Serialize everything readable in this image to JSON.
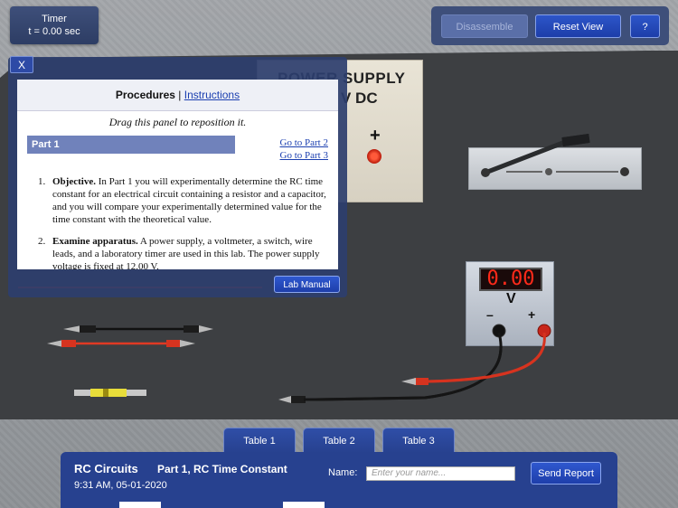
{
  "timer": {
    "label": "Timer",
    "value": "t = 0.00 sec"
  },
  "toolbar": {
    "disassemble": "Disassemble",
    "reset_view": "Reset View",
    "help": "?"
  },
  "power_supply": {
    "title_line1": "POWER SUPPLY",
    "title_line2": "V DC",
    "plus": "+"
  },
  "voltmeter": {
    "reading": "0.00",
    "unit": "V",
    "minus": "–",
    "plus": "+"
  },
  "panel": {
    "close": "X",
    "header_title": "Procedures",
    "header_sep": "|",
    "header_link": "Instructions",
    "drag_hint": "Drag this panel to reposition it.",
    "part_label": "Part 1",
    "goto_part2": "Go to Part 2",
    "goto_part3": "Go to Part 3",
    "items": [
      {
        "num": "1.",
        "title": "Objective.",
        "text": "In Part 1 you will experimentally determine the RC time constant for an electrical circuit containing a resistor and a capacitor, and you will compare your experimentally determined value for the time constant with the theoretical value."
      },
      {
        "num": "2.",
        "title": "Examine apparatus.",
        "text": "A power supply, a voltmeter, a switch, wire leads, and a laboratory timer are used in this lab. The power supply voltage is fixed at 12.00 V."
      }
    ],
    "lab_manual": "Lab Manual"
  },
  "tabs": [
    "Table 1",
    "Table 2",
    "Table 3"
  ],
  "report": {
    "title": "RC Circuits",
    "part": "Part 1, RC Time Constant",
    "datetime": "9:31 AM, 05-01-2020",
    "name_label": "Name:",
    "name_placeholder": "Enter your name...",
    "send": "Send Report"
  },
  "colors": {
    "accent": "#27418f",
    "button": "#1e3eaa",
    "board": "#3d3f42",
    "meter_red": "#ff2a1a"
  }
}
